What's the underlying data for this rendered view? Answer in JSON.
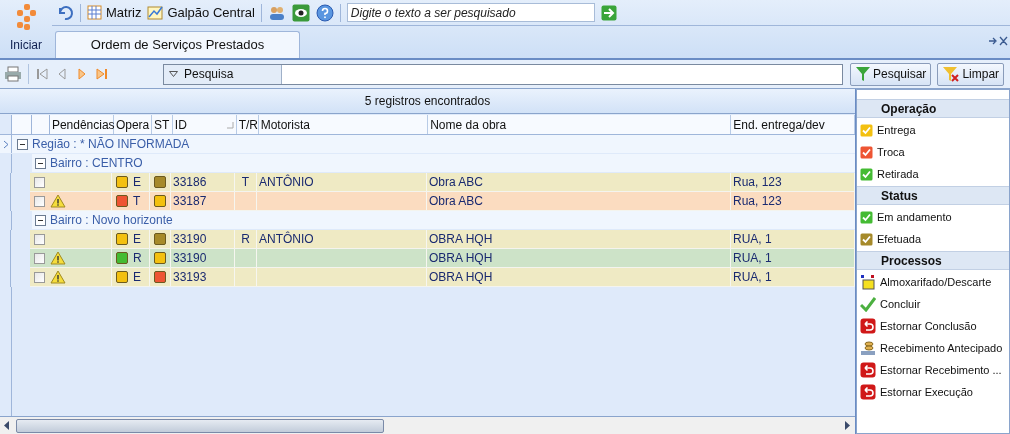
{
  "start_button": {
    "label": "Iniciar"
  },
  "toolbar": {
    "items": [
      {
        "label": "Matriz",
        "kind": "grid"
      },
      {
        "label": "Galpão Central",
        "kind": "chart"
      }
    ],
    "search": {
      "placeholder": "Digite o texto a ser pesquisado"
    }
  },
  "tabs": [
    {
      "label": "Ordem de Serviços Prestados",
      "selected": true
    }
  ],
  "filter": {
    "label": "Pesquisa",
    "buttons": [
      {
        "label": "Pesquisar",
        "kind": "search"
      },
      {
        "label": "Limpar",
        "kind": "clear"
      }
    ]
  },
  "grid": {
    "summary": "5 registros encontrados",
    "columns": [
      "Pendências",
      "Opera",
      "ST",
      "ID",
      "T/R",
      "Motorista",
      "Nome da obra",
      "End. entrega/dev"
    ],
    "region": {
      "label": "Região : * NÃO INFORMADA",
      "expanded": true,
      "children": [
        {
          "label": "Bairro : CENTRO",
          "expanded": true,
          "rows": [
            {
              "color": "#efeac4",
              "checked": false,
              "warning": false,
              "operation": {
                "code": "E",
                "color": "#f3c010"
              },
              "status": {
                "color": "#a68a2a"
              },
              "id": "33186",
              "tr": "T",
              "motorista": "ANTÔNIO",
              "obra": "Obra ABC",
              "endereco": "Rua, 123"
            },
            {
              "color": "#fbdcc0",
              "checked": false,
              "warning": true,
              "operation": {
                "code": "T",
                "color": "#ee5533"
              },
              "status": {
                "color": "#f3c010"
              },
              "id": "33187",
              "obra": "Obra ABC",
              "endereco": "Rua, 123"
            }
          ]
        },
        {
          "label": "Bairro : Novo horizonte",
          "expanded": true,
          "rows": [
            {
              "color": "#efeac4",
              "checked": false,
              "warning": false,
              "operation": {
                "code": "E",
                "color": "#f3c010"
              },
              "status": {
                "color": "#a68a2a"
              },
              "id": "33190",
              "tr": "R",
              "motorista": "ANTÔNIO",
              "obra": "OBRA HQH",
              "endereco": "RUA, 1"
            },
            {
              "color": "#cde3c8",
              "checked": false,
              "warning": true,
              "operation": {
                "code": "R",
                "color": "#44bb33"
              },
              "status": {
                "color": "#f3c010"
              },
              "id": "33190",
              "obra": "OBRA HQH",
              "endereco": "RUA, 1"
            },
            {
              "color": "#efeac4",
              "checked": false,
              "warning": true,
              "operation": {
                "code": "E",
                "color": "#f3c010"
              },
              "status": {
                "color": "#ee5533"
              },
              "id": "33193",
              "obra": "OBRA HQH",
              "endereco": "RUA, 1"
            }
          ]
        }
      ]
    }
  },
  "side_panel": [
    {
      "title": "Operação",
      "items": [
        {
          "label": "Entrega",
          "kind": "check",
          "color": "#f3c010"
        },
        {
          "label": "Troca",
          "kind": "check",
          "color": "#ee5533"
        },
        {
          "label": "Retirada",
          "kind": "check",
          "color": "#44bb33"
        }
      ]
    },
    {
      "title": "Status",
      "items": [
        {
          "label": "Em andamento",
          "kind": "check",
          "color": "#44bb33"
        },
        {
          "label": "Efetuada",
          "kind": "check",
          "color": "#a68a2a"
        }
      ]
    },
    {
      "title": "Processos",
      "items": [
        {
          "label": "Almoxarifado/Descarte",
          "kind": "box"
        },
        {
          "label": "Concluir",
          "kind": "tick"
        },
        {
          "label": "Estornar Conclusão",
          "kind": "undo"
        },
        {
          "label": "Recebimento Antecipado",
          "kind": "coins"
        },
        {
          "label": "Estornar Recebimento ...",
          "kind": "undo"
        },
        {
          "label": "Estornar Execução",
          "kind": "undo"
        }
      ]
    }
  ]
}
